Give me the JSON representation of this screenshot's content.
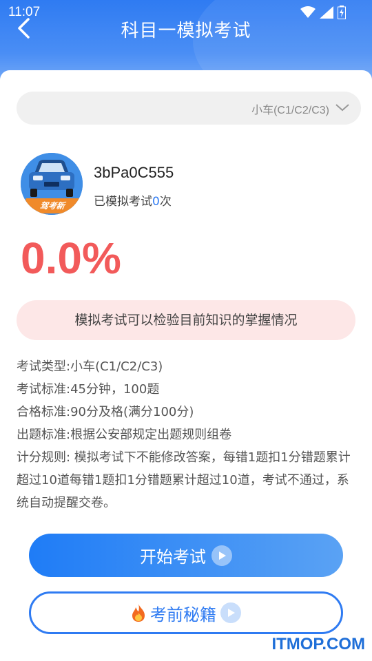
{
  "status_bar": {
    "time": "11:07"
  },
  "header": {
    "title": "科目一模拟考试"
  },
  "selector": {
    "value": "小车(C1/C2/C3)"
  },
  "profile": {
    "username": "3bPa0C555",
    "count_prefix": "已模拟考试",
    "count": "0",
    "count_suffix": "次",
    "avatar_banner": "驾考新"
  },
  "score": "0.0%",
  "tip": "模拟考试可以检验目前知识的掌握情况",
  "rules": [
    "考试类型:小车(C1/C2/C3)",
    "考试标准:45分钟，100题",
    "合格标准:90分及格(满分100分)",
    "出题标准:根据公安部规定出题规则组卷",
    "计分规则: 模拟考试下不能修改答案，每错1题扣1分错题累计超过10道每错1题扣1分错题累计超过10道，考试不通过，系统自动提醒交卷。"
  ],
  "buttons": {
    "start": "开始考试",
    "tips": "考前秘籍"
  },
  "watermark": "ITMOP.COM",
  "colors": {
    "primary": "#2f7bf2",
    "score": "#f25a5a",
    "tip_bg": "#fde7e7"
  }
}
